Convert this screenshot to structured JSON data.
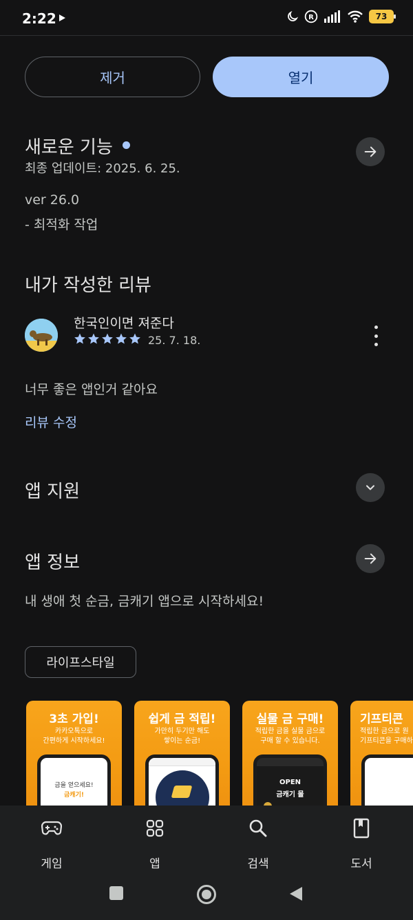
{
  "status_bar": {
    "time": "2:22",
    "battery": "73"
  },
  "actions": {
    "remove_label": "제거",
    "open_label": "열기"
  },
  "whats_new": {
    "title": "새로운 기능",
    "updated": "최종 업데이트: 2025. 6. 25.",
    "version": "ver 26.0",
    "note": "- 최적화 작업"
  },
  "my_review": {
    "title": "내가 작성한 리뷰",
    "author": "한국인이면 져준다",
    "rating": 5,
    "date": "25. 7. 18.",
    "text": "너무 좋은 앱인거 같아요",
    "edit_label": "리뷰 수정"
  },
  "app_support": {
    "title": "앱 지원"
  },
  "app_info": {
    "title": "앱 정보",
    "description": "내 생애 첫 순금, 금캐기 앱으로 시작하세요!",
    "category": "라이프스타일"
  },
  "screenshots": [
    {
      "title": "3초 가입!",
      "subtitle": "카카오톡으로\n간편하게 시작하세요!",
      "screen_text": "금을 얻으세요!",
      "screen_text2": "금캐기!"
    },
    {
      "title": "쉽게 금 적립!",
      "subtitle": "가만히 두기만 해도\n쌓이는 순금!"
    },
    {
      "title": "실물 금 구매!",
      "subtitle": "적립한 금을 실물 금으로\n구매 할 수 있습니다.",
      "screen_text": "OPEN",
      "screen_text2": "금캐기 몰"
    },
    {
      "title": "기프티콘",
      "subtitle": "적립한 금으로 원\n기프티콘을 구매하"
    }
  ],
  "bottom_nav": [
    {
      "label": "게임",
      "icon": "gamepad-icon"
    },
    {
      "label": "앱",
      "icon": "apps-grid-icon"
    },
    {
      "label": "검색",
      "icon": "search-icon"
    },
    {
      "label": "도서",
      "icon": "book-icon"
    }
  ],
  "colors": {
    "accent": "#a8c7fa",
    "background": "#131314",
    "banner_orange": "#f8a51c"
  }
}
